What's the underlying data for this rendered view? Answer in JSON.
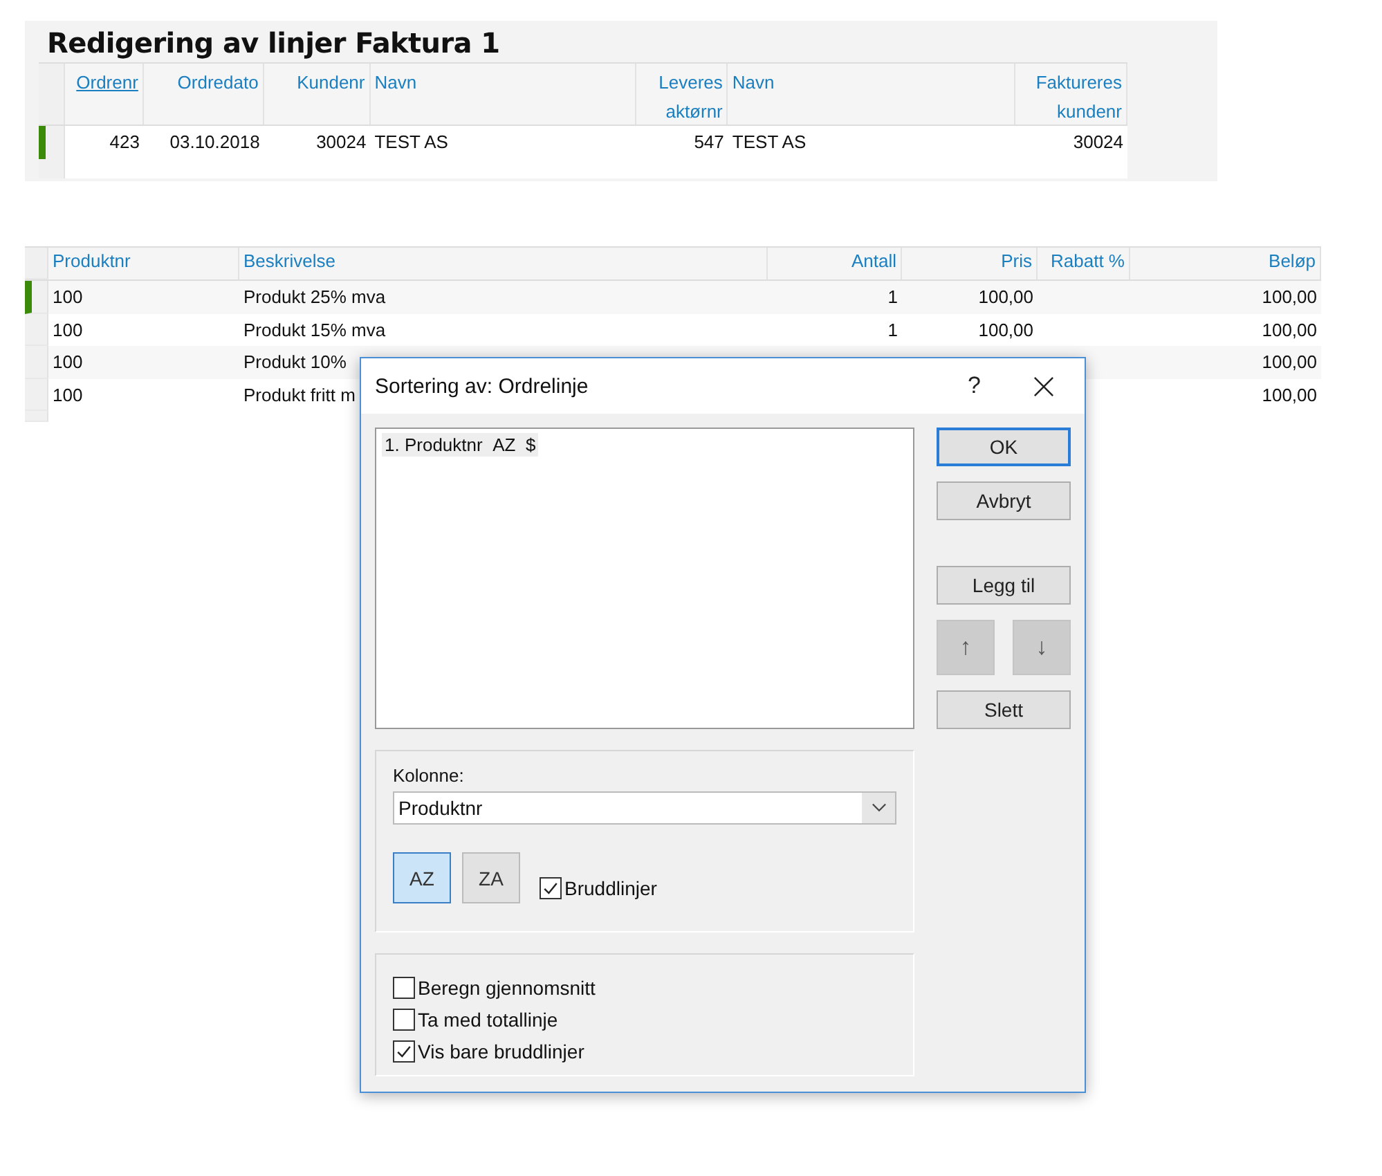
{
  "invoice": {
    "title": "Redigering av linjer Faktura 1",
    "columns": [
      {
        "label": "Ordrenr",
        "sorted": true
      },
      {
        "label": "Ordredato",
        "sorted": false
      },
      {
        "label": "Kundenr",
        "sorted": false
      },
      {
        "label": "Navn",
        "sorted": false
      },
      {
        "label": "Leveres aktørnr",
        "sorted": false
      },
      {
        "label": "Navn",
        "sorted": false
      },
      {
        "label": "Faktureres kundenr",
        "sorted": false
      }
    ],
    "rows": [
      {
        "selected": true,
        "cells": [
          "423",
          "03.10.2018",
          "30024",
          "TEST AS",
          "547",
          "TEST AS",
          "30024"
        ]
      }
    ]
  },
  "lines": {
    "columns": [
      "Produktnr",
      "Beskrivelse",
      "Antall",
      "Pris",
      "Rabatt %",
      "Beløp"
    ],
    "rows": [
      {
        "selected": true,
        "cells": [
          "100",
          "Produkt 25% mva",
          "1",
          "100,00",
          null,
          "100,00"
        ]
      },
      {
        "selected": false,
        "cells": [
          "100",
          "Produkt 15% mva",
          "1",
          "100,00",
          null,
          "100,00"
        ]
      },
      {
        "selected": false,
        "cells": [
          "100",
          "Produkt 10%",
          null,
          null,
          null,
          "100,00"
        ]
      },
      {
        "selected": false,
        "cells": [
          "100",
          "Produkt fritt m",
          null,
          null,
          null,
          "100,00"
        ]
      }
    ]
  },
  "dialog": {
    "title": "Sortering av: Ordrelinje",
    "help": "?",
    "sort_list": [
      {
        "number": "1.",
        "column": "Produktnr",
        "order": "AZ",
        "flag": "$",
        "selected": true
      }
    ],
    "buttons": [
      {
        "label": "OK",
        "kind": "default"
      },
      {
        "label": "Avbryt",
        "kind": "plain"
      },
      {
        "label": "Legg til",
        "kind": "plain"
      },
      {
        "label": "↑",
        "kind": "arrow"
      },
      {
        "label": "↓",
        "kind": "arrow"
      },
      {
        "label": "Slett",
        "kind": "plain"
      }
    ],
    "column_label": "Kolonne:",
    "column_value": "Produktnr",
    "order_buttons": [
      {
        "label": "AZ",
        "selected": true
      },
      {
        "label": "ZA",
        "selected": false
      }
    ],
    "break_lines": {
      "label": "Bruddlinjer",
      "checked": true
    },
    "options": [
      {
        "label": "Beregn gjennomsnitt",
        "checked": false
      },
      {
        "label": "Ta med totallinje",
        "checked": false
      },
      {
        "label": "Vis bare bruddlinjer",
        "checked": true
      }
    ]
  }
}
